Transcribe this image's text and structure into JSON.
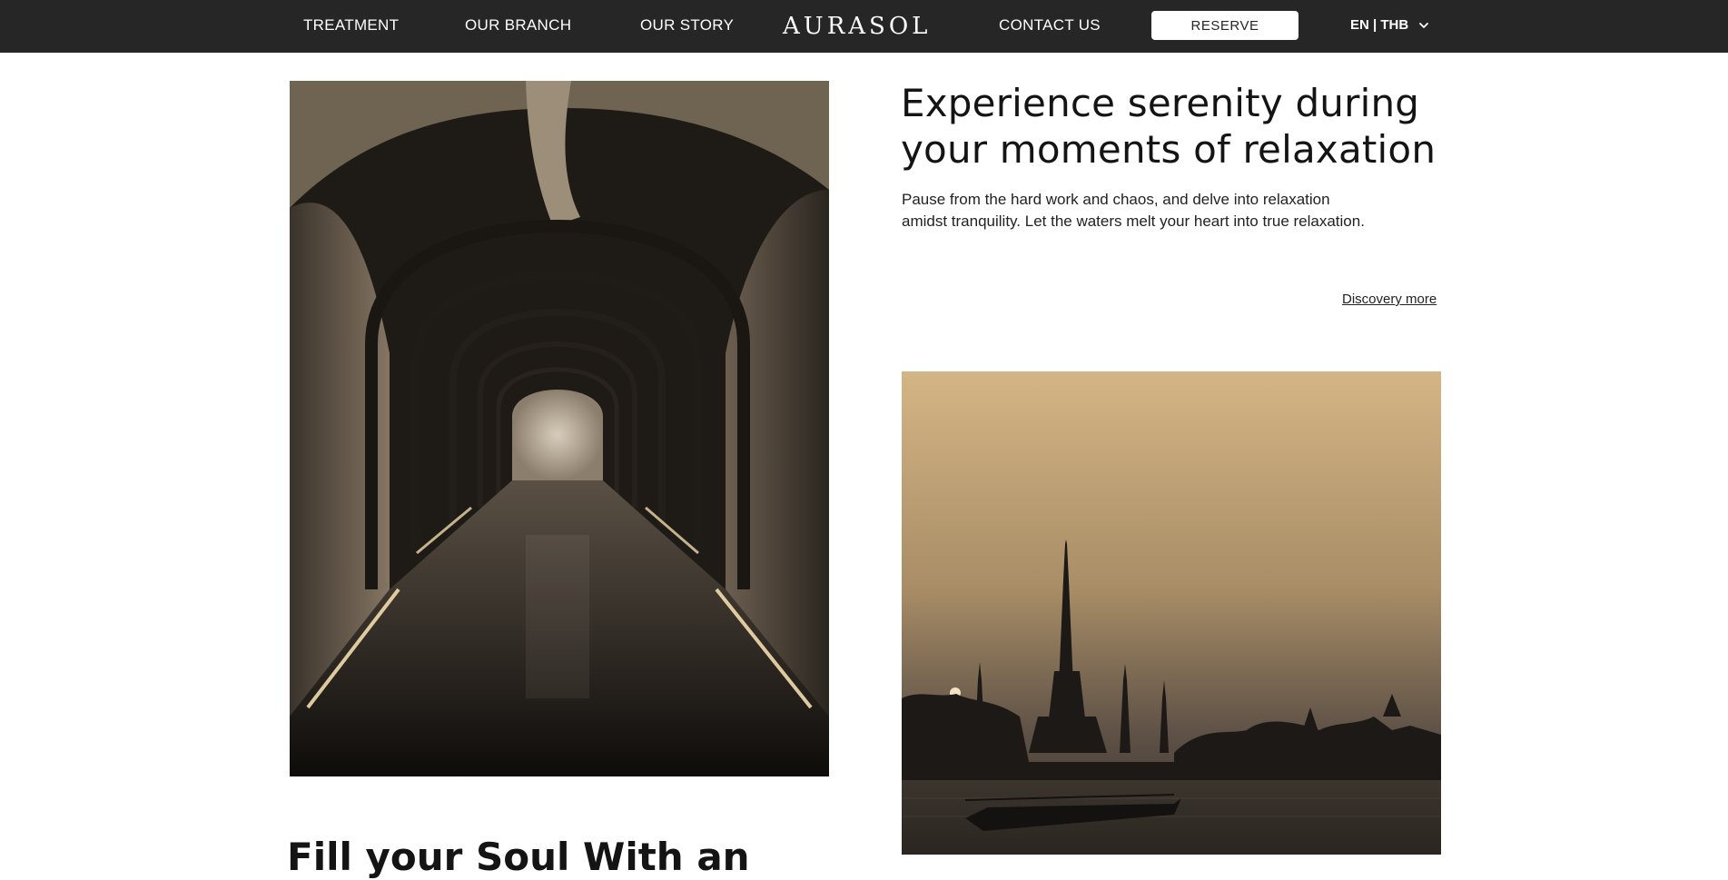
{
  "nav": {
    "treatment": "TREATMENT",
    "branch": "OUR BRANCH",
    "story": "OUR STORY",
    "logo": "AURASOL",
    "contact": "CONTACT US",
    "reserve": "RESERVE",
    "language": "EN | THB"
  },
  "intro": {
    "headline_line1": "Experience serenity during",
    "headline_line2": "your moments of relaxation",
    "description": "Pause from the hard work and chaos,  and delve into relaxation amidst tranquility.   Let the waters melt your heart into true relaxation.",
    "link": "Discovery more"
  },
  "section2": {
    "heading": "Fill your Soul With an"
  },
  "images": {
    "corridor": "corridor-photo",
    "temple": "temple-sunset-photo"
  },
  "colors": {
    "nav_bg": "#262626",
    "text": "#141414",
    "reserve_bg": "#ffffff"
  },
  "icons": {
    "language_toggle": "chevron-down-icon"
  }
}
